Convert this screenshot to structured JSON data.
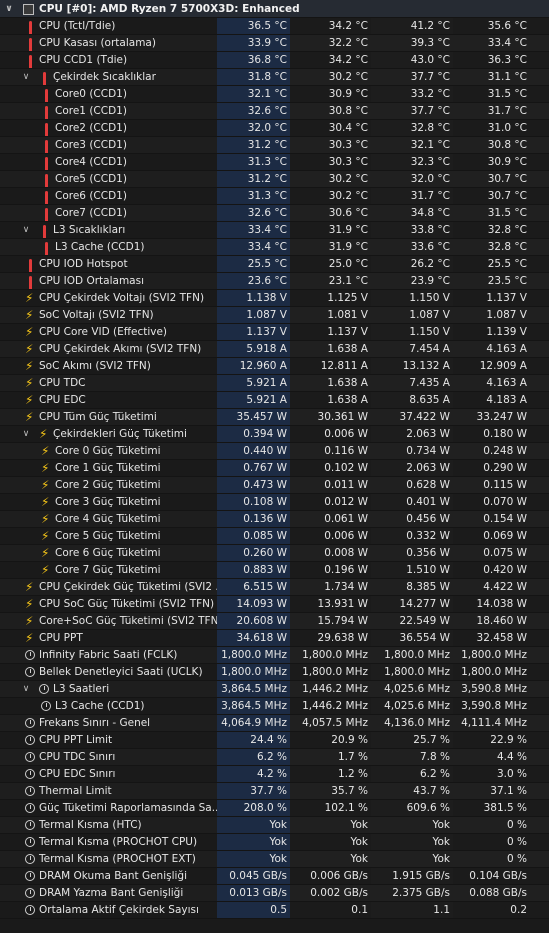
{
  "header": {
    "title": "CPU [#0]: AMD Ryzen 7 5700X3D: Enhanced"
  },
  "rows": [
    {
      "label": "CPU (Tctl/Tdie)",
      "v": [
        "36.5 °C",
        "34.2 °C",
        "41.2 °C",
        "35.6 °C"
      ],
      "icon": "therm",
      "indent": 0
    },
    {
      "label": "CPU Kasası (ortalama)",
      "v": [
        "33.9 °C",
        "32.2 °C",
        "39.3 °C",
        "33.4 °C"
      ],
      "icon": "therm",
      "indent": 0
    },
    {
      "label": "CPU CCD1 (Tdie)",
      "v": [
        "36.8 °C",
        "34.2 °C",
        "43.0 °C",
        "36.3 °C"
      ],
      "icon": "therm",
      "indent": 0
    },
    {
      "label": "Çekirdek Sıcaklıklar",
      "v": [
        "31.8 °C",
        "30.2 °C",
        "37.7 °C",
        "31.1 °C"
      ],
      "icon": "therm",
      "indent": 1,
      "chev": true
    },
    {
      "label": "Core0 (CCD1)",
      "v": [
        "32.1 °C",
        "30.9 °C",
        "33.2 °C",
        "31.5 °C"
      ],
      "icon": "therm",
      "indent": 2
    },
    {
      "label": "Core1 (CCD1)",
      "v": [
        "32.6 °C",
        "30.8 °C",
        "37.7 °C",
        "31.7 °C"
      ],
      "icon": "therm",
      "indent": 2
    },
    {
      "label": "Core2 (CCD1)",
      "v": [
        "32.0 °C",
        "30.4 °C",
        "32.8 °C",
        "31.0 °C"
      ],
      "icon": "therm",
      "indent": 2
    },
    {
      "label": "Core3 (CCD1)",
      "v": [
        "31.2 °C",
        "30.3 °C",
        "32.1 °C",
        "30.8 °C"
      ],
      "icon": "therm",
      "indent": 2
    },
    {
      "label": "Core4 (CCD1)",
      "v": [
        "31.3 °C",
        "30.3 °C",
        "32.3 °C",
        "30.9 °C"
      ],
      "icon": "therm",
      "indent": 2
    },
    {
      "label": "Core5 (CCD1)",
      "v": [
        "31.2 °C",
        "30.2 °C",
        "32.0 °C",
        "30.7 °C"
      ],
      "icon": "therm",
      "indent": 2
    },
    {
      "label": "Core6 (CCD1)",
      "v": [
        "31.3 °C",
        "30.2 °C",
        "31.7 °C",
        "30.7 °C"
      ],
      "icon": "therm",
      "indent": 2
    },
    {
      "label": "Core7 (CCD1)",
      "v": [
        "32.6 °C",
        "30.6 °C",
        "34.8 °C",
        "31.5 °C"
      ],
      "icon": "therm",
      "indent": 2
    },
    {
      "label": "L3 Sıcaklıkları",
      "v": [
        "33.4 °C",
        "31.9 °C",
        "33.8 °C",
        "32.8 °C"
      ],
      "icon": "therm",
      "indent": 1,
      "chev": true
    },
    {
      "label": "L3 Cache (CCD1)",
      "v": [
        "33.4 °C",
        "31.9 °C",
        "33.6 °C",
        "32.8 °C"
      ],
      "icon": "therm",
      "indent": 2
    },
    {
      "label": "CPU IOD Hotspot",
      "v": [
        "25.5 °C",
        "25.0 °C",
        "26.2 °C",
        "25.5 °C"
      ],
      "icon": "therm",
      "indent": 0
    },
    {
      "label": "CPU IOD Ortalaması",
      "v": [
        "23.6 °C",
        "23.1 °C",
        "23.9 °C",
        "23.5 °C"
      ],
      "icon": "therm",
      "indent": 0
    },
    {
      "label": "CPU Çekirdek Voltajı (SVI2 TFN)",
      "v": [
        "1.138 V",
        "1.125 V",
        "1.150 V",
        "1.137 V"
      ],
      "icon": "bolt",
      "indent": 0
    },
    {
      "label": "SoC Voltajı (SVI2 TFN)",
      "v": [
        "1.087 V",
        "1.081 V",
        "1.087 V",
        "1.087 V"
      ],
      "icon": "bolt",
      "indent": 0
    },
    {
      "label": "CPU Core VID (Effective)",
      "v": [
        "1.137 V",
        "1.137 V",
        "1.150 V",
        "1.139 V"
      ],
      "icon": "bolt",
      "indent": 0
    },
    {
      "label": "CPU Çekirdek Akımı (SVI2 TFN)",
      "v": [
        "5.918 A",
        "1.638 A",
        "7.454 A",
        "4.163 A"
      ],
      "icon": "bolt",
      "indent": 0
    },
    {
      "label": "SoC Akımı (SVI2 TFN)",
      "v": [
        "12.960 A",
        "12.811 A",
        "13.132 A",
        "12.909 A"
      ],
      "icon": "bolt",
      "indent": 0
    },
    {
      "label": "CPU TDC",
      "v": [
        "5.921 A",
        "1.638 A",
        "7.435 A",
        "4.163 A"
      ],
      "icon": "bolt",
      "indent": 0
    },
    {
      "label": "CPU EDC",
      "v": [
        "5.921 A",
        "1.638 A",
        "8.635 A",
        "4.183 A"
      ],
      "icon": "bolt",
      "indent": 0
    },
    {
      "label": "CPU Tüm Güç Tüketimi",
      "v": [
        "35.457 W",
        "30.361 W",
        "37.422 W",
        "33.247 W"
      ],
      "icon": "bolt",
      "indent": 0
    },
    {
      "label": "Çekirdekleri Güç Tüketimi",
      "v": [
        "0.394 W",
        "0.006 W",
        "2.063 W",
        "0.180 W"
      ],
      "icon": "bolt",
      "indent": 1,
      "chev": true
    },
    {
      "label": "Core 0 Güç Tüketimi",
      "v": [
        "0.440 W",
        "0.116 W",
        "0.734 W",
        "0.248 W"
      ],
      "icon": "bolt",
      "indent": 2
    },
    {
      "label": "Core 1 Güç Tüketimi",
      "v": [
        "0.767 W",
        "0.102 W",
        "2.063 W",
        "0.290 W"
      ],
      "icon": "bolt",
      "indent": 2
    },
    {
      "label": "Core 2 Güç Tüketimi",
      "v": [
        "0.473 W",
        "0.011 W",
        "0.628 W",
        "0.115 W"
      ],
      "icon": "bolt",
      "indent": 2
    },
    {
      "label": "Core 3 Güç Tüketimi",
      "v": [
        "0.108 W",
        "0.012 W",
        "0.401 W",
        "0.070 W"
      ],
      "icon": "bolt",
      "indent": 2
    },
    {
      "label": "Core 4 Güç Tüketimi",
      "v": [
        "0.136 W",
        "0.061 W",
        "0.456 W",
        "0.154 W"
      ],
      "icon": "bolt",
      "indent": 2
    },
    {
      "label": "Core 5 Güç Tüketimi",
      "v": [
        "0.085 W",
        "0.006 W",
        "0.332 W",
        "0.069 W"
      ],
      "icon": "bolt",
      "indent": 2
    },
    {
      "label": "Core 6 Güç Tüketimi",
      "v": [
        "0.260 W",
        "0.008 W",
        "0.356 W",
        "0.075 W"
      ],
      "icon": "bolt",
      "indent": 2
    },
    {
      "label": "Core 7 Güç Tüketimi",
      "v": [
        "0.883 W",
        "0.196 W",
        "1.510 W",
        "0.420 W"
      ],
      "icon": "bolt",
      "indent": 2
    },
    {
      "label": "CPU Çekirdek Güç Tüketimi (SVI2 ...",
      "v": [
        "6.515 W",
        "1.734 W",
        "8.385 W",
        "4.422 W"
      ],
      "icon": "bolt",
      "indent": 0
    },
    {
      "label": "CPU SoC Güç Tüketimi (SVI2 TFN)",
      "v": [
        "14.093 W",
        "13.931 W",
        "14.277 W",
        "14.038 W"
      ],
      "icon": "bolt",
      "indent": 0
    },
    {
      "label": "Core+SoC Güç Tüketimi (SVI2 TFN)",
      "v": [
        "20.608 W",
        "15.794 W",
        "22.549 W",
        "18.460 W"
      ],
      "icon": "bolt",
      "indent": 0
    },
    {
      "label": "CPU PPT",
      "v": [
        "34.618 W",
        "29.638 W",
        "36.554 W",
        "32.458 W"
      ],
      "icon": "bolt",
      "indent": 0
    },
    {
      "label": "Infinity Fabric Saati (FCLK)",
      "v": [
        "1,800.0 MHz",
        "1,800.0 MHz",
        "1,800.0 MHz",
        "1,800.0 MHz"
      ],
      "icon": "clock",
      "indent": 0
    },
    {
      "label": "Bellek Denetleyici Saati (UCLK)",
      "v": [
        "1,800.0 MHz",
        "1,800.0 MHz",
        "1,800.0 MHz",
        "1,800.0 MHz"
      ],
      "icon": "clock",
      "indent": 0
    },
    {
      "label": "L3 Saatleri",
      "v": [
        "3,864.5 MHz",
        "1,446.2 MHz",
        "4,025.6 MHz",
        "3,590.8 MHz"
      ],
      "icon": "clock",
      "indent": 1,
      "chev": true
    },
    {
      "label": "L3 Cache (CCD1)",
      "v": [
        "3,864.5 MHz",
        "1,446.2 MHz",
        "4,025.6 MHz",
        "3,590.8 MHz"
      ],
      "icon": "clock",
      "indent": 2
    },
    {
      "label": "Frekans Sınırı - Genel",
      "v": [
        "4,064.9 MHz",
        "4,057.5 MHz",
        "4,136.0 MHz",
        "4,111.4 MHz"
      ],
      "icon": "clock",
      "indent": 0
    },
    {
      "label": "CPU PPT Limit",
      "v": [
        "24.4 %",
        "20.9 %",
        "25.7 %",
        "22.9 %"
      ],
      "icon": "clock",
      "indent": 0
    },
    {
      "label": "CPU TDC Sınırı",
      "v": [
        "6.2 %",
        "1.7 %",
        "7.8 %",
        "4.4 %"
      ],
      "icon": "clock",
      "indent": 0
    },
    {
      "label": "CPU EDC Sınırı",
      "v": [
        "4.2 %",
        "1.2 %",
        "6.2 %",
        "3.0 %"
      ],
      "icon": "clock",
      "indent": 0
    },
    {
      "label": "Thermal Limit",
      "v": [
        "37.7 %",
        "35.7 %",
        "43.7 %",
        "37.1 %"
      ],
      "icon": "clock",
      "indent": 0
    },
    {
      "label": "Güç Tüketimi Raporlamasında Sa...",
      "v": [
        "208.0 %",
        "102.1 %",
        "609.6 %",
        "381.5 %"
      ],
      "icon": "clock",
      "indent": 0
    },
    {
      "label": "Termal Kısma (HTC)",
      "v": [
        "Yok",
        "Yok",
        "Yok",
        "0 %"
      ],
      "icon": "clock",
      "indent": 0
    },
    {
      "label": "Termal Kısma (PROCHOT CPU)",
      "v": [
        "Yok",
        "Yok",
        "Yok",
        "0 %"
      ],
      "icon": "clock",
      "indent": 0
    },
    {
      "label": "Termal Kısma (PROCHOT EXT)",
      "v": [
        "Yok",
        "Yok",
        "Yok",
        "0 %"
      ],
      "icon": "clock",
      "indent": 0
    },
    {
      "label": "DRAM Okuma Bant Genişliği",
      "v": [
        "0.045 GB/s",
        "0.006 GB/s",
        "1.915 GB/s",
        "0.104 GB/s"
      ],
      "icon": "clock",
      "indent": 0
    },
    {
      "label": "DRAM Yazma Bant Genişliği",
      "v": [
        "0.013 GB/s",
        "0.002 GB/s",
        "2.375 GB/s",
        "0.088 GB/s"
      ],
      "icon": "clock",
      "indent": 0
    },
    {
      "label": "Ortalama Aktif Çekirdek Sayısı",
      "v": [
        "0.5",
        "0.1",
        "1.1",
        "0.2"
      ],
      "icon": "clock",
      "indent": 0
    }
  ]
}
